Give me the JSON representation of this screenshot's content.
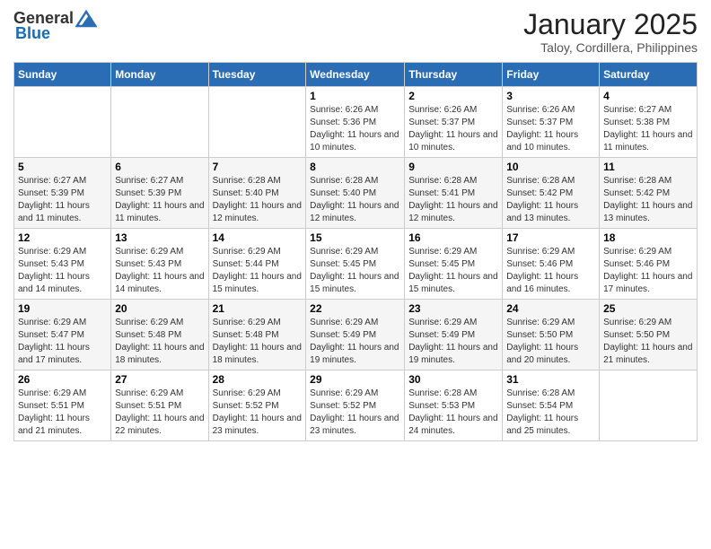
{
  "header": {
    "logo_general": "General",
    "logo_blue": "Blue",
    "month_year": "January 2025",
    "location": "Taloy, Cordillera, Philippines"
  },
  "days_of_week": [
    "Sunday",
    "Monday",
    "Tuesday",
    "Wednesday",
    "Thursday",
    "Friday",
    "Saturday"
  ],
  "weeks": [
    {
      "days": [
        {
          "num": "",
          "sunrise": "",
          "sunset": "",
          "daylight": ""
        },
        {
          "num": "",
          "sunrise": "",
          "sunset": "",
          "daylight": ""
        },
        {
          "num": "",
          "sunrise": "",
          "sunset": "",
          "daylight": ""
        },
        {
          "num": "1",
          "sunrise": "Sunrise: 6:26 AM",
          "sunset": "Sunset: 5:36 PM",
          "daylight": "Daylight: 11 hours and 10 minutes."
        },
        {
          "num": "2",
          "sunrise": "Sunrise: 6:26 AM",
          "sunset": "Sunset: 5:37 PM",
          "daylight": "Daylight: 11 hours and 10 minutes."
        },
        {
          "num": "3",
          "sunrise": "Sunrise: 6:26 AM",
          "sunset": "Sunset: 5:37 PM",
          "daylight": "Daylight: 11 hours and 10 minutes."
        },
        {
          "num": "4",
          "sunrise": "Sunrise: 6:27 AM",
          "sunset": "Sunset: 5:38 PM",
          "daylight": "Daylight: 11 hours and 11 minutes."
        }
      ]
    },
    {
      "days": [
        {
          "num": "5",
          "sunrise": "Sunrise: 6:27 AM",
          "sunset": "Sunset: 5:39 PM",
          "daylight": "Daylight: 11 hours and 11 minutes."
        },
        {
          "num": "6",
          "sunrise": "Sunrise: 6:27 AM",
          "sunset": "Sunset: 5:39 PM",
          "daylight": "Daylight: 11 hours and 11 minutes."
        },
        {
          "num": "7",
          "sunrise": "Sunrise: 6:28 AM",
          "sunset": "Sunset: 5:40 PM",
          "daylight": "Daylight: 11 hours and 12 minutes."
        },
        {
          "num": "8",
          "sunrise": "Sunrise: 6:28 AM",
          "sunset": "Sunset: 5:40 PM",
          "daylight": "Daylight: 11 hours and 12 minutes."
        },
        {
          "num": "9",
          "sunrise": "Sunrise: 6:28 AM",
          "sunset": "Sunset: 5:41 PM",
          "daylight": "Daylight: 11 hours and 12 minutes."
        },
        {
          "num": "10",
          "sunrise": "Sunrise: 6:28 AM",
          "sunset": "Sunset: 5:42 PM",
          "daylight": "Daylight: 11 hours and 13 minutes."
        },
        {
          "num": "11",
          "sunrise": "Sunrise: 6:28 AM",
          "sunset": "Sunset: 5:42 PM",
          "daylight": "Daylight: 11 hours and 13 minutes."
        }
      ]
    },
    {
      "days": [
        {
          "num": "12",
          "sunrise": "Sunrise: 6:29 AM",
          "sunset": "Sunset: 5:43 PM",
          "daylight": "Daylight: 11 hours and 14 minutes."
        },
        {
          "num": "13",
          "sunrise": "Sunrise: 6:29 AM",
          "sunset": "Sunset: 5:43 PM",
          "daylight": "Daylight: 11 hours and 14 minutes."
        },
        {
          "num": "14",
          "sunrise": "Sunrise: 6:29 AM",
          "sunset": "Sunset: 5:44 PM",
          "daylight": "Daylight: 11 hours and 15 minutes."
        },
        {
          "num": "15",
          "sunrise": "Sunrise: 6:29 AM",
          "sunset": "Sunset: 5:45 PM",
          "daylight": "Daylight: 11 hours and 15 minutes."
        },
        {
          "num": "16",
          "sunrise": "Sunrise: 6:29 AM",
          "sunset": "Sunset: 5:45 PM",
          "daylight": "Daylight: 11 hours and 15 minutes."
        },
        {
          "num": "17",
          "sunrise": "Sunrise: 6:29 AM",
          "sunset": "Sunset: 5:46 PM",
          "daylight": "Daylight: 11 hours and 16 minutes."
        },
        {
          "num": "18",
          "sunrise": "Sunrise: 6:29 AM",
          "sunset": "Sunset: 5:46 PM",
          "daylight": "Daylight: 11 hours and 17 minutes."
        }
      ]
    },
    {
      "days": [
        {
          "num": "19",
          "sunrise": "Sunrise: 6:29 AM",
          "sunset": "Sunset: 5:47 PM",
          "daylight": "Daylight: 11 hours and 17 minutes."
        },
        {
          "num": "20",
          "sunrise": "Sunrise: 6:29 AM",
          "sunset": "Sunset: 5:48 PM",
          "daylight": "Daylight: 11 hours and 18 minutes."
        },
        {
          "num": "21",
          "sunrise": "Sunrise: 6:29 AM",
          "sunset": "Sunset: 5:48 PM",
          "daylight": "Daylight: 11 hours and 18 minutes."
        },
        {
          "num": "22",
          "sunrise": "Sunrise: 6:29 AM",
          "sunset": "Sunset: 5:49 PM",
          "daylight": "Daylight: 11 hours and 19 minutes."
        },
        {
          "num": "23",
          "sunrise": "Sunrise: 6:29 AM",
          "sunset": "Sunset: 5:49 PM",
          "daylight": "Daylight: 11 hours and 19 minutes."
        },
        {
          "num": "24",
          "sunrise": "Sunrise: 6:29 AM",
          "sunset": "Sunset: 5:50 PM",
          "daylight": "Daylight: 11 hours and 20 minutes."
        },
        {
          "num": "25",
          "sunrise": "Sunrise: 6:29 AM",
          "sunset": "Sunset: 5:50 PM",
          "daylight": "Daylight: 11 hours and 21 minutes."
        }
      ]
    },
    {
      "days": [
        {
          "num": "26",
          "sunrise": "Sunrise: 6:29 AM",
          "sunset": "Sunset: 5:51 PM",
          "daylight": "Daylight: 11 hours and 21 minutes."
        },
        {
          "num": "27",
          "sunrise": "Sunrise: 6:29 AM",
          "sunset": "Sunset: 5:51 PM",
          "daylight": "Daylight: 11 hours and 22 minutes."
        },
        {
          "num": "28",
          "sunrise": "Sunrise: 6:29 AM",
          "sunset": "Sunset: 5:52 PM",
          "daylight": "Daylight: 11 hours and 23 minutes."
        },
        {
          "num": "29",
          "sunrise": "Sunrise: 6:29 AM",
          "sunset": "Sunset: 5:52 PM",
          "daylight": "Daylight: 11 hours and 23 minutes."
        },
        {
          "num": "30",
          "sunrise": "Sunrise: 6:28 AM",
          "sunset": "Sunset: 5:53 PM",
          "daylight": "Daylight: 11 hours and 24 minutes."
        },
        {
          "num": "31",
          "sunrise": "Sunrise: 6:28 AM",
          "sunset": "Sunset: 5:54 PM",
          "daylight": "Daylight: 11 hours and 25 minutes."
        },
        {
          "num": "",
          "sunrise": "",
          "sunset": "",
          "daylight": ""
        }
      ]
    }
  ]
}
